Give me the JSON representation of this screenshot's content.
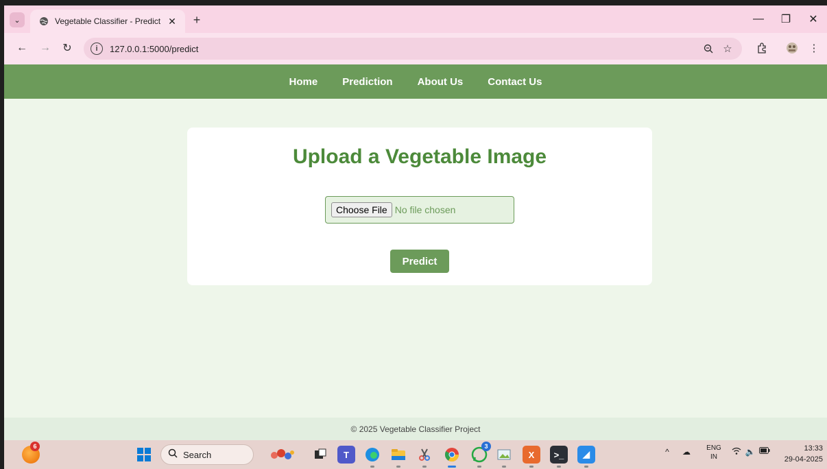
{
  "browser": {
    "tab_title": "Vegetable Classifier - Predict",
    "tab_close": "✕",
    "new_tab": "+",
    "url": "127.0.0.1:5000/predict",
    "window_controls": {
      "minimize": "—",
      "restore": "❐",
      "close": "✕"
    }
  },
  "nav": {
    "items": [
      "Home",
      "Prediction",
      "About Us",
      "Contact Us"
    ]
  },
  "main": {
    "heading": "Upload a Vegetable Image",
    "file_button": "Choose File",
    "file_status": "No file chosen",
    "predict_button": "Predict"
  },
  "footer": {
    "text": "© 2025 Vegetable Classifier Project"
  },
  "taskbar": {
    "weather_badge": "6",
    "search_placeholder": "Search",
    "whatsapp_badge": "3",
    "lang_top": "ENG",
    "lang_bottom": "IN",
    "time": "13:33",
    "date": "29-04-2025"
  },
  "colors": {
    "nav_green": "#6c9b5a",
    "heading_green": "#4c8a3a",
    "page_bg": "#eef6ea",
    "chrome_pink": "#f9d5e5"
  }
}
